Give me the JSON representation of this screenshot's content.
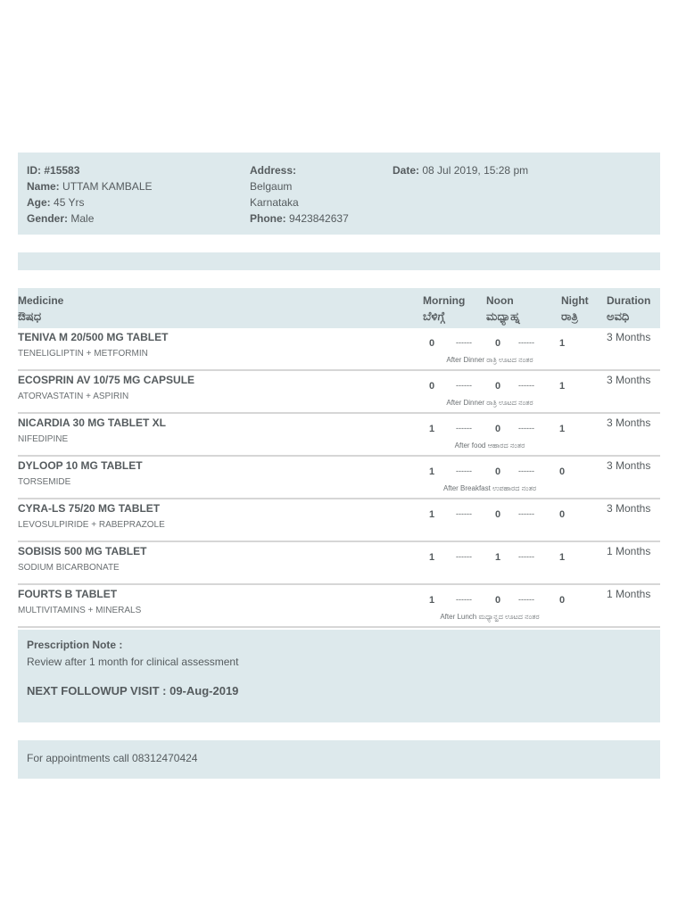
{
  "patient": {
    "id_label": "ID:",
    "id_value": "#15583",
    "name_label": "Name:",
    "name_value": "UTTAM KAMBALE",
    "age_label": "Age:",
    "age_value": "45 Yrs",
    "gender_label": "Gender:",
    "gender_value": "Male",
    "address_label": "Address:",
    "address_line1": "Belgaum",
    "address_line2": "Karnataka",
    "phone_label": "Phone:",
    "phone_value": "9423842637",
    "date_label": "Date:",
    "date_value": "08 Jul 2019, 15:28 pm"
  },
  "table_header": {
    "medicine": "Medicine",
    "medicine_kn": "ಔಷಧ",
    "morning": "Morning",
    "morning_kn": "ಬೆಳಿಗ್ಗೆ",
    "noon": "Noon",
    "noon_kn": "ಮಧ್ಯಾಹ್ನ",
    "night": "Night",
    "night_kn": "ರಾತ್ರಿ",
    "duration": "Duration",
    "duration_kn": "ಅವಧಿ"
  },
  "dash": "------",
  "medicines": [
    {
      "name": "TENIVA M 20/500 MG TABLET",
      "generic": "TENELIGLIPTIN + METFORMIN",
      "morning": "0",
      "noon": "0",
      "night": "1",
      "instruction": "After Dinner ರಾತ್ರಿ ಊಟದ ನಂತರ",
      "duration": "3 Months"
    },
    {
      "name": "ECOSPRIN AV 10/75 MG CAPSULE",
      "generic": "ATORVASTATIN + ASPIRIN",
      "morning": "0",
      "noon": "0",
      "night": "1",
      "instruction": "After Dinner ರಾತ್ರಿ ಊಟದ ನಂತರ",
      "duration": "3 Months"
    },
    {
      "name": "NICARDIA 30 MG TABLET XL",
      "generic": "NIFEDIPINE",
      "morning": "1",
      "noon": "0",
      "night": "1",
      "instruction": "After food ಆಹಾರದ ನಂತರ",
      "duration": "3 Months"
    },
    {
      "name": "DYLOOP 10 MG TABLET",
      "generic": "TORSEMIDE",
      "morning": "1",
      "noon": "0",
      "night": "0",
      "instruction": "After Breakfast ಉಪಹಾರದ ನಂತರ",
      "duration": "3 Months"
    },
    {
      "name": "CYRA-LS 75/20 MG TABLET",
      "generic": "LEVOSULPIRIDE + RABEPRAZOLE",
      "morning": "1",
      "noon": "0",
      "night": "0",
      "instruction": "",
      "duration": "3 Months"
    },
    {
      "name": "SOBISIS 500 MG TABLET",
      "generic": "SODIUM BICARBONATE",
      "morning": "1",
      "noon": "1",
      "night": "1",
      "instruction": "",
      "duration": "1 Months"
    },
    {
      "name": "FOURTS B TABLET",
      "generic": "MULTIVITAMINS + MINERALS",
      "morning": "1",
      "noon": "0",
      "night": "0",
      "instruction": "After Lunch ಮಧ್ಯಾನ್ಹದ ಊಟದ ನಂತರ",
      "duration": "1 Months"
    }
  ],
  "note": {
    "title": "Prescription Note :",
    "body": "Review after 1 month for clinical assessment",
    "followup": "NEXT FOLLOWUP VISIT : 09-Aug-2019"
  },
  "appointment": "For appointments call 08312470424"
}
